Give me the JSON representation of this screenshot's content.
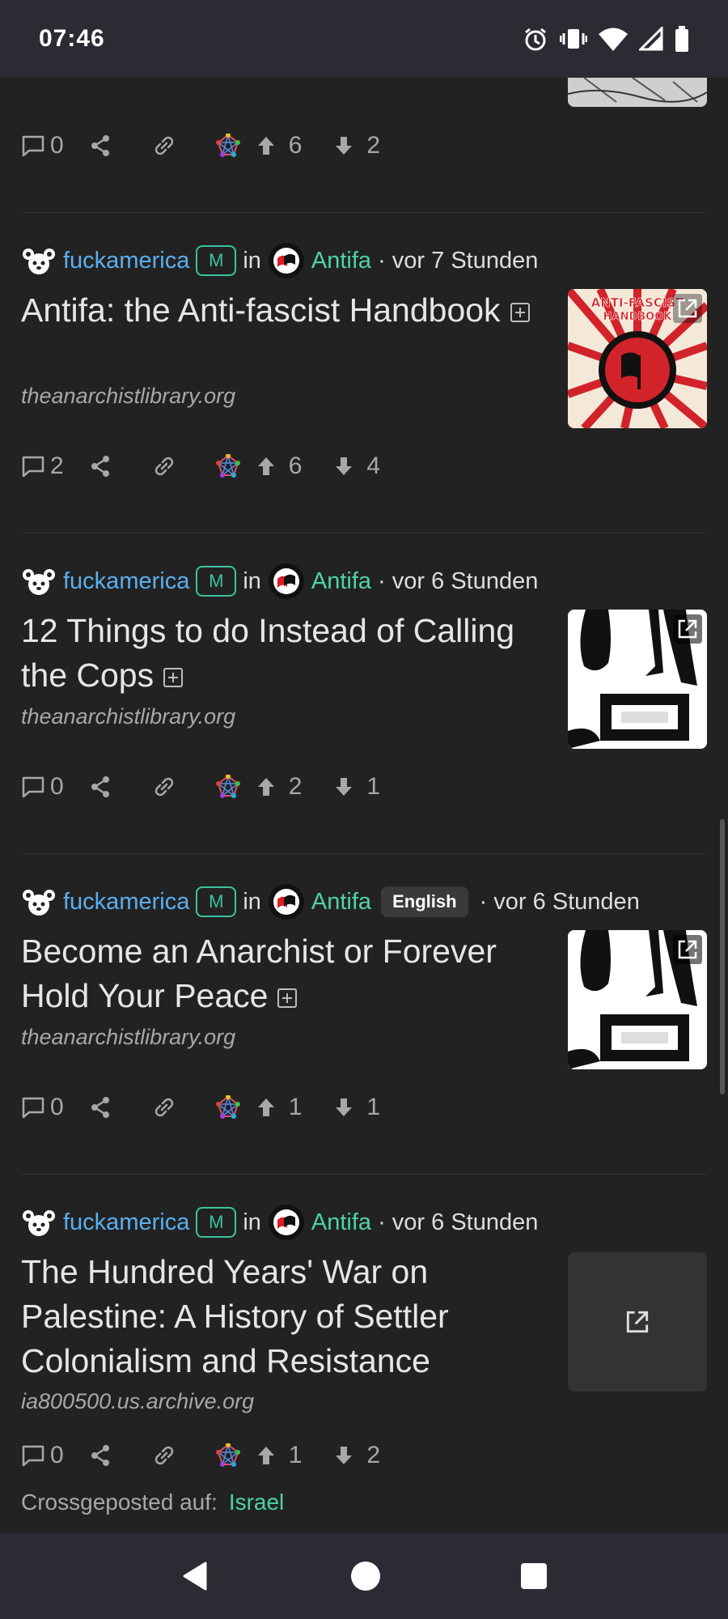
{
  "status_bar": {
    "time": "07:46",
    "icons": [
      "alarm-icon",
      "vibrate-icon",
      "wifi-icon",
      "signal-icon",
      "battery-icon"
    ]
  },
  "colors": {
    "background": "#222222",
    "username": "#5ab0f0",
    "community": "#4fd2a9",
    "mod_badge": "#3cc3a0",
    "muted": "#a8a8a8"
  },
  "top_post_actions": {
    "comments": "0",
    "upvotes": "6",
    "downvotes": "2"
  },
  "posts": [
    {
      "author": "fuckamerica",
      "mod_badge": "M",
      "in_label": "in",
      "community": "Antifa",
      "time": "· vor 7 Stunden",
      "title": "Antifa: the Anti-fascist Handbook",
      "domain": "theanarchistlibrary.org",
      "comments": "2",
      "upvotes": "6",
      "downvotes": "4",
      "thumb_text": [
        "ANTI-FASCIST",
        "HANDBOOK"
      ]
    },
    {
      "author": "fuckamerica",
      "mod_badge": "M",
      "in_label": "in",
      "community": "Antifa",
      "time": "· vor 6 Stunden",
      "title": "12 Things to do Instead of Calling the Cops",
      "domain": "theanarchistlibrary.org",
      "comments": "0",
      "upvotes": "2",
      "downvotes": "1"
    },
    {
      "author": "fuckamerica",
      "mod_badge": "M",
      "in_label": "in",
      "community": "Antifa",
      "language": "English",
      "time": "· vor 6 Stunden",
      "title": "Become an Anarchist or Forever Hold Your Peace",
      "domain": "theanarchistlibrary.org",
      "comments": "0",
      "upvotes": "1",
      "downvotes": "1"
    },
    {
      "author": "fuckamerica",
      "mod_badge": "M",
      "in_label": "in",
      "community": "Antifa",
      "time": "· vor 6 Stunden",
      "title": "The Hundred Years' War on Palestine: A History of Settler Colonialism and Resistance",
      "domain": "ia800500.us.archive.org",
      "comments": "0",
      "upvotes": "1",
      "downvotes": "2",
      "crosspost_label": "Crossgeposted auf:",
      "crosspost_target": "Israel"
    }
  ],
  "nav_bar": {
    "icons": [
      "back-icon",
      "home-icon",
      "recents-icon"
    ]
  }
}
